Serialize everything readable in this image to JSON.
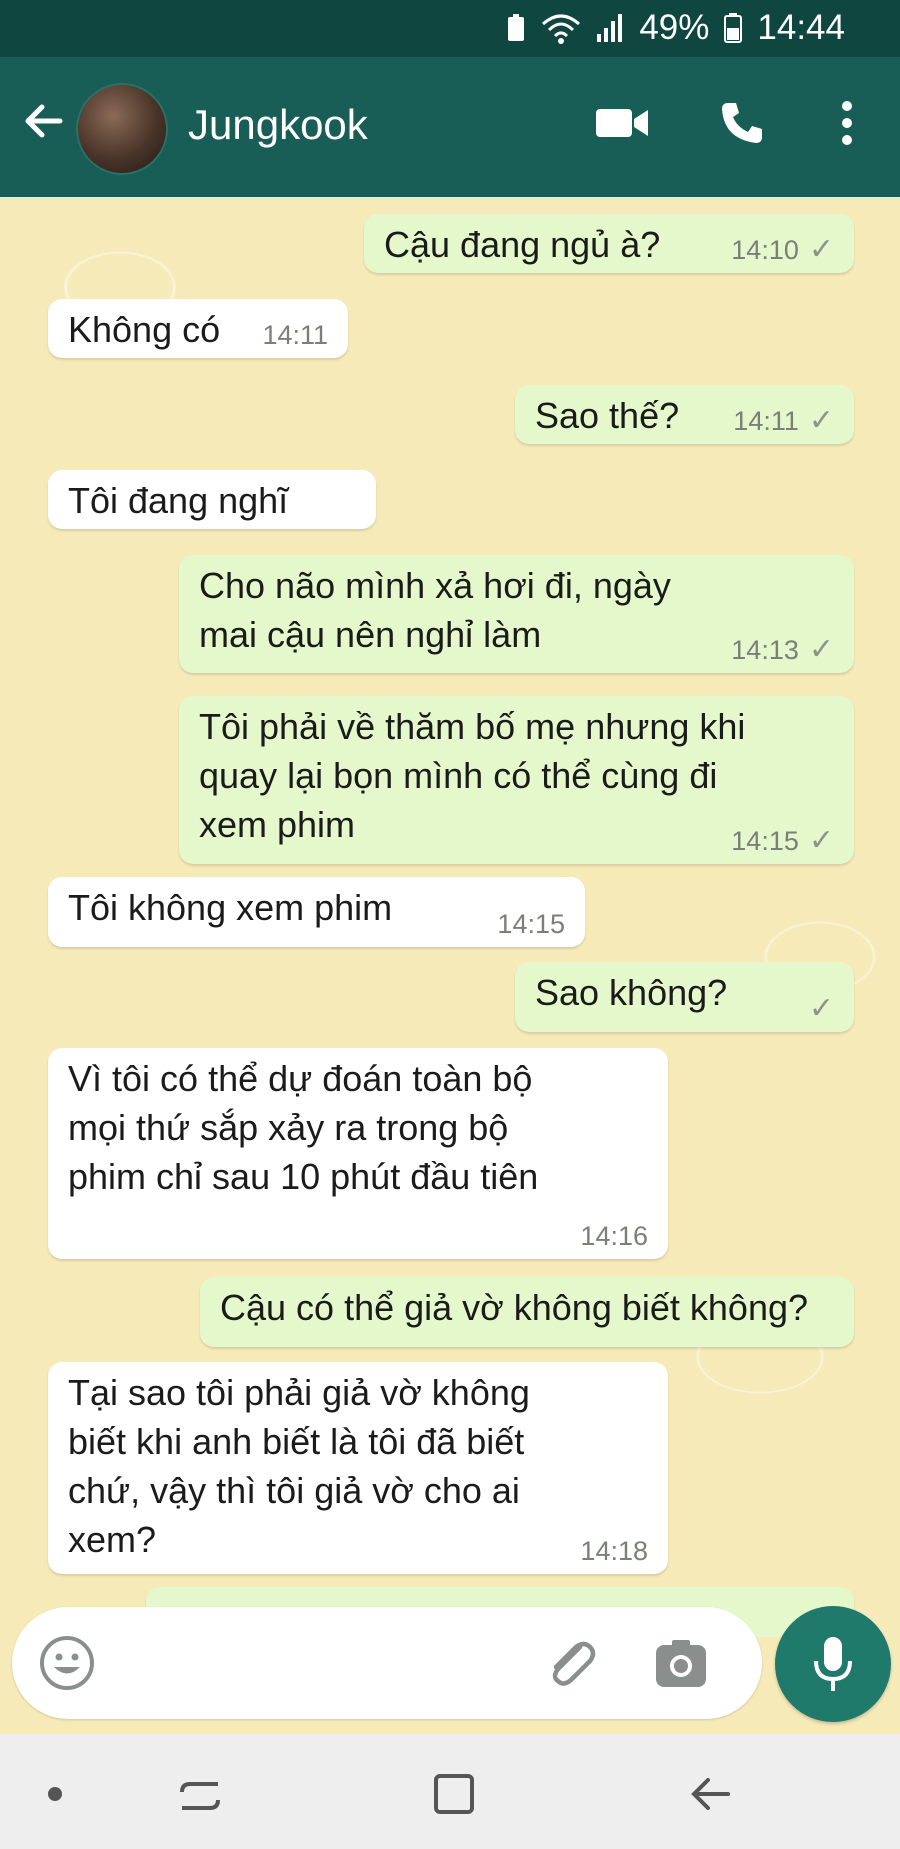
{
  "status_bar": {
    "battery": "49%",
    "time": "14:44"
  },
  "header": {
    "contact_name": "Jungkook"
  },
  "messages": [
    {
      "dir": "out",
      "text": "Cậu đang ngủ à?",
      "time": "14:10",
      "tick": "✓"
    },
    {
      "dir": "in",
      "text": "Không có",
      "time": "14:11"
    },
    {
      "dir": "out",
      "text": "Sao thế?",
      "time": "14:11",
      "tick": "✓"
    },
    {
      "dir": "in",
      "text": "Tôi đang nghĩ",
      "time": ""
    },
    {
      "dir": "out",
      "text": "Cho não mình xả hơi đi, ngày mai cậu nên nghỉ làm",
      "time": "14:13",
      "tick": "✓"
    },
    {
      "dir": "out",
      "text": "Tôi phải về thăm bố mẹ nhưng khi quay lại bọn mình có thể cùng đi xem phim",
      "time": "14:15",
      "tick": "✓"
    },
    {
      "dir": "in",
      "text": "Tôi không xem phim",
      "time": "14:15"
    },
    {
      "dir": "out",
      "text": "Sao không?",
      "time": "",
      "tick": "✓"
    },
    {
      "dir": "in",
      "text": "Vì tôi có thể dự đoán toàn bộ mọi thứ sắp xảy ra trong bộ phim chỉ sau 10 phút đầu tiên",
      "time": "14:16"
    },
    {
      "dir": "out",
      "text": "Cậu có thể giả vờ không biết không?",
      "time": ""
    },
    {
      "dir": "in",
      "text": "Tại sao tôi phải giả vờ không biết khi anh biết là tôi đã biết chứ, vậy thì tôi giả vờ cho ai xem?",
      "time": "14:18"
    }
  ],
  "icons": {
    "back": "arrow-left-icon",
    "video": "video-call-icon",
    "call": "phone-icon",
    "menu": "more-vert-icon",
    "emoji": "emoji-icon",
    "attach": "paperclip-icon",
    "camera": "camera-icon",
    "mic": "microphone-icon"
  },
  "colors": {
    "header": "#195e56",
    "status": "#0f463f",
    "outgoing": "#e4f8cb",
    "incoming": "#ffffff",
    "wallpaper": "#f5eab8",
    "mic_button": "#1f7a6c"
  }
}
